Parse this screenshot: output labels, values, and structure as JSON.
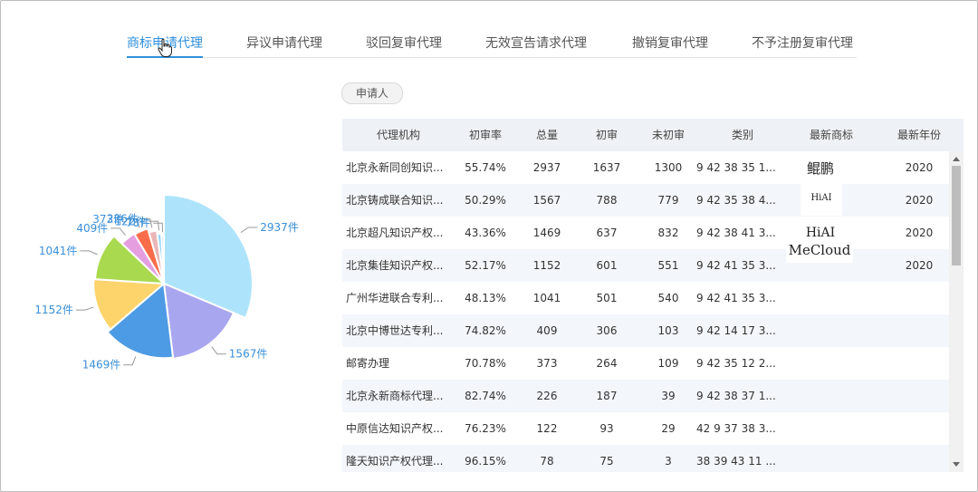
{
  "tabs": [
    {
      "label": "商标申请代理",
      "active": true
    },
    {
      "label": "异议申请代理",
      "active": false
    },
    {
      "label": "驳回复审代理",
      "active": false
    },
    {
      "label": "无效宣告请求代理",
      "active": false
    },
    {
      "label": "撤销复审代理",
      "active": false
    },
    {
      "label": "不予注册复审代理",
      "active": false
    }
  ],
  "filter": {
    "applicant_label": "申请人"
  },
  "table": {
    "headers": [
      "代理机构",
      "初审率",
      "总量",
      "初审",
      "未初审",
      "类别",
      "最新商标",
      "最新年份"
    ],
    "rows": [
      {
        "agency": "北京永新同创知识...",
        "rate": "55.74%",
        "total": "2937",
        "initial": "1637",
        "pending": "1300",
        "classes": "9 42 38 35 1...",
        "latest_mark": "鲲鹏",
        "latest_year": "2020"
      },
      {
        "agency": "北京铸成联合知识...",
        "rate": "50.29%",
        "total": "1567",
        "initial": "788",
        "pending": "779",
        "classes": "9 42 35 38 4...",
        "latest_mark": "HiAI",
        "latest_year": "2020"
      },
      {
        "agency": "北京超凡知识产权...",
        "rate": "43.36%",
        "total": "1469",
        "initial": "637",
        "pending": "832",
        "classes": "9 42 38 41 3...",
        "latest_mark": "HiAI",
        "latest_year": "2020"
      },
      {
        "agency": "北京集佳知识产权...",
        "rate": "52.17%",
        "total": "1152",
        "initial": "601",
        "pending": "551",
        "classes": "9 42 41 35 3...",
        "latest_mark": "MeCloud",
        "latest_year": "2020"
      },
      {
        "agency": "广州华进联合专利...",
        "rate": "48.13%",
        "total": "1041",
        "initial": "501",
        "pending": "540",
        "classes": "9 42 41 35 3...",
        "latest_mark": "",
        "latest_year": ""
      },
      {
        "agency": "北京中博世达专利...",
        "rate": "74.82%",
        "total": "409",
        "initial": "306",
        "pending": "103",
        "classes": "9 42 14 17 3...",
        "latest_mark": "",
        "latest_year": ""
      },
      {
        "agency": "邮寄办理",
        "rate": "70.78%",
        "total": "373",
        "initial": "264",
        "pending": "109",
        "classes": "9 42 35 12 2...",
        "latest_mark": "",
        "latest_year": ""
      },
      {
        "agency": "北京永新商标代理...",
        "rate": "82.74%",
        "total": "226",
        "initial": "187",
        "pending": "39",
        "classes": "9 42 38 37 1...",
        "latest_mark": "",
        "latest_year": ""
      },
      {
        "agency": "中原信达知识产权...",
        "rate": "76.23%",
        "total": "122",
        "initial": "93",
        "pending": "29",
        "classes": "42 9 37 38 3...",
        "latest_mark": "",
        "latest_year": ""
      },
      {
        "agency": "隆天知识产权代理...",
        "rate": "96.15%",
        "total": "78",
        "initial": "75",
        "pending": "3",
        "classes": "38 39 43 11 ...",
        "latest_mark": "",
        "latest_year": ""
      }
    ]
  },
  "chart_data": {
    "type": "pie",
    "title": "",
    "unit_suffix": "件",
    "series": [
      {
        "name": "北京永新同创知识...",
        "value": 2937,
        "color": "#aee4fb"
      },
      {
        "name": "北京铸成联合知识...",
        "value": 1567,
        "color": "#a9a6f0"
      },
      {
        "name": "北京超凡知识产权...",
        "value": 1469,
        "color": "#4d9be4"
      },
      {
        "name": "北京集佳知识产权...",
        "value": 1152,
        "color": "#fdd46c"
      },
      {
        "name": "广州华进联合专利...",
        "value": 1041,
        "color": "#a9d94e"
      },
      {
        "name": "北京中博世达专利...",
        "value": 409,
        "color": "#e59ee0"
      },
      {
        "name": "邮寄办理",
        "value": 373,
        "color": "#fb6d4a"
      },
      {
        "name": "北京永新商标代理...",
        "value": 226,
        "color": "#e9b6b8"
      },
      {
        "name": "中原信达知识产权...",
        "value": 122,
        "color": "#8fd3f7"
      },
      {
        "name": "隆天知识产权代理...",
        "value": 78,
        "color": "#c7e6f7"
      }
    ],
    "labels": [
      "2937件",
      "1567件",
      "1469件",
      "1152件",
      "1041件",
      "409件",
      "373件",
      "226件",
      "122件",
      "78件"
    ],
    "label_color": "#3a8fd8",
    "rose_type": "radius"
  }
}
